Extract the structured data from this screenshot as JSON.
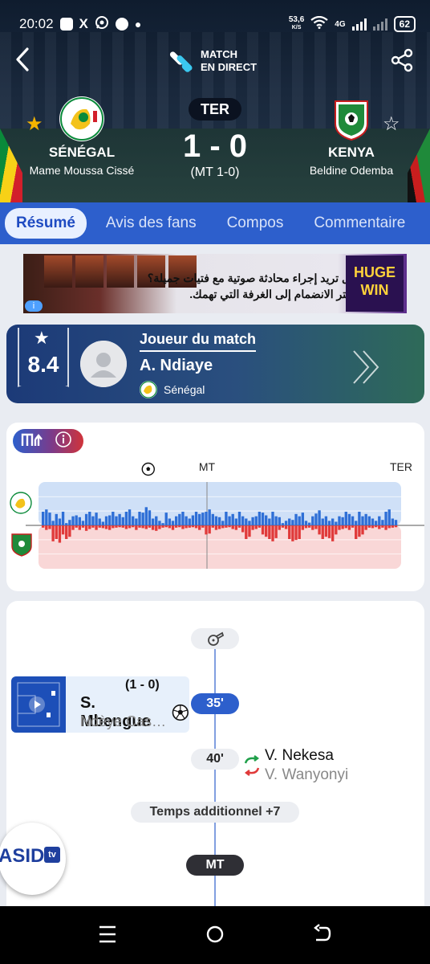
{
  "status_bar": {
    "time": "20:02",
    "x_label": "X",
    "net_speed": "53,6",
    "net_unit": "K/S",
    "network": "4G",
    "battery": "62"
  },
  "header": {
    "title_line1": "MATCH",
    "title_line2": "EN DIRECT",
    "period": "TER",
    "score": "1 - 0",
    "ht_score": "(MT 1-0)",
    "home": {
      "name": "SÉNÉGAL",
      "scorer": "Mame Moussa Cissé",
      "favorite": true
    },
    "away": {
      "name": "KENYA",
      "scorer": "Beldine Odemba",
      "favorite": false,
      "crest_text": "FOOTBALL\nKENYA"
    }
  },
  "tabs": [
    {
      "label": "Résumé",
      "active": true
    },
    {
      "label": "Avis des fans",
      "active": false
    },
    {
      "label": "Compos",
      "active": false
    },
    {
      "label": "Commentaire",
      "active": false
    }
  ],
  "ad": {
    "line1": "هل تريد إجراء محادثة صوتية مع فتيات جميلة؟",
    "line2": "اختر الانضمام إلى الغرفة التي تهمك.",
    "win1": "HUGE",
    "win2": "WIN",
    "info": "i"
  },
  "potm": {
    "rating": "8.4",
    "label": "Joueur du match",
    "name": "A. Ndiaye",
    "team": "Sénégal"
  },
  "momentum": {
    "ht_label": "MT",
    "ft_label": "TER",
    "home_values": [
      0.3,
      0.35,
      0.28,
      0.1,
      0.25,
      0.15,
      0.3,
      0.05,
      0.12,
      0.2,
      0.22,
      0.18,
      0.1,
      0.25,
      0.3,
      0.2,
      0.28,
      0.15,
      0.08,
      0.2,
      0.22,
      0.3,
      0.2,
      0.25,
      0.18,
      0.3,
      0.35,
      0.2,
      0.15,
      0.3,
      0.28,
      0.4,
      0.33,
      0.15,
      0.2,
      0.1,
      0.05,
      0.28,
      0.15,
      0.1,
      0.2,
      0.25,
      0.3,
      0.2,
      0.15,
      0.22,
      0.3,
      0.25,
      0.28,
      0.3,
      0.35,
      0.25,
      0.2,
      0.18,
      0.1,
      0.3,
      0.2,
      0.25,
      0.15,
      0.3,
      0.2,
      0.15,
      0.1,
      0.18,
      0.2,
      0.3,
      0.28,
      0.22,
      0.15,
      0.3,
      0.2,
      0.18,
      0.05,
      0.1,
      0.15,
      0.12,
      0.25,
      0.2,
      0.28,
      0.1,
      0.06,
      0.2,
      0.26,
      0.33,
      0.15,
      0.2,
      0.1,
      0.15,
      0.08,
      0.2,
      0.18,
      0.3,
      0.25,
      0.2,
      0.1,
      0.3,
      0.2,
      0.25,
      0.2,
      0.15,
      0.1,
      0.2,
      0.12,
      0.3,
      0.35,
      0.15,
      0.12
    ],
    "away_values": [
      0.05,
      0.1,
      0.08,
      0.35,
      0.3,
      0.38,
      0.2,
      0.3,
      0.25,
      0.1,
      0.05,
      0.1,
      0.05,
      0.12,
      0.08,
      0.05,
      0.1,
      0.05,
      0.06,
      0.08,
      0.1,
      0.06,
      0.05,
      0.04,
      0.05,
      0.08,
      0.06,
      0.04,
      0.1,
      0.05,
      0.06,
      0.08,
      0.05,
      0.1,
      0.12,
      0.08,
      0.05,
      0.04,
      0.06,
      0.1,
      0.05,
      0.04,
      0.08,
      0.06,
      0.05,
      0.04,
      0.06,
      0.1,
      0.05,
      0.2,
      0.18,
      0.05,
      0.1,
      0.08,
      0.06,
      0.05,
      0.04,
      0.08,
      0.1,
      0.05,
      0.15,
      0.3,
      0.25,
      0.1,
      0.08,
      0.05,
      0.2,
      0.25,
      0.3,
      0.35,
      0.28,
      0.1,
      0.05,
      0.08,
      0.3,
      0.35,
      0.32,
      0.3,
      0.1,
      0.06,
      0.05,
      0.1,
      0.08,
      0.2,
      0.3,
      0.25,
      0.28,
      0.35,
      0.2,
      0.1,
      0.08,
      0.06,
      0.1,
      0.05,
      0.3,
      0.25,
      0.2,
      0.1,
      0.05,
      0.06,
      0.04,
      0.08,
      0.05,
      0.1,
      0.06,
      0.05,
      0.04
    ]
  },
  "timeline": {
    "goal": {
      "score": "(1 - 0)",
      "scorer": "S. Mbengue",
      "assist": "Ndèye Cas…",
      "minute": "35'"
    },
    "sub": {
      "minute": "40'",
      "player_in": "V. Nekesa",
      "player_out": "V. Wanyonyi"
    },
    "added_time": "Temps additionnel +7",
    "ht": "MT"
  },
  "floating": {
    "label": "ASID",
    "tv": "tv"
  },
  "colors": {
    "accent": "#2d5fcc",
    "home_bar": "#2f6fd6",
    "away_bar": "#e03a3a",
    "favorite": "#f5b400"
  }
}
